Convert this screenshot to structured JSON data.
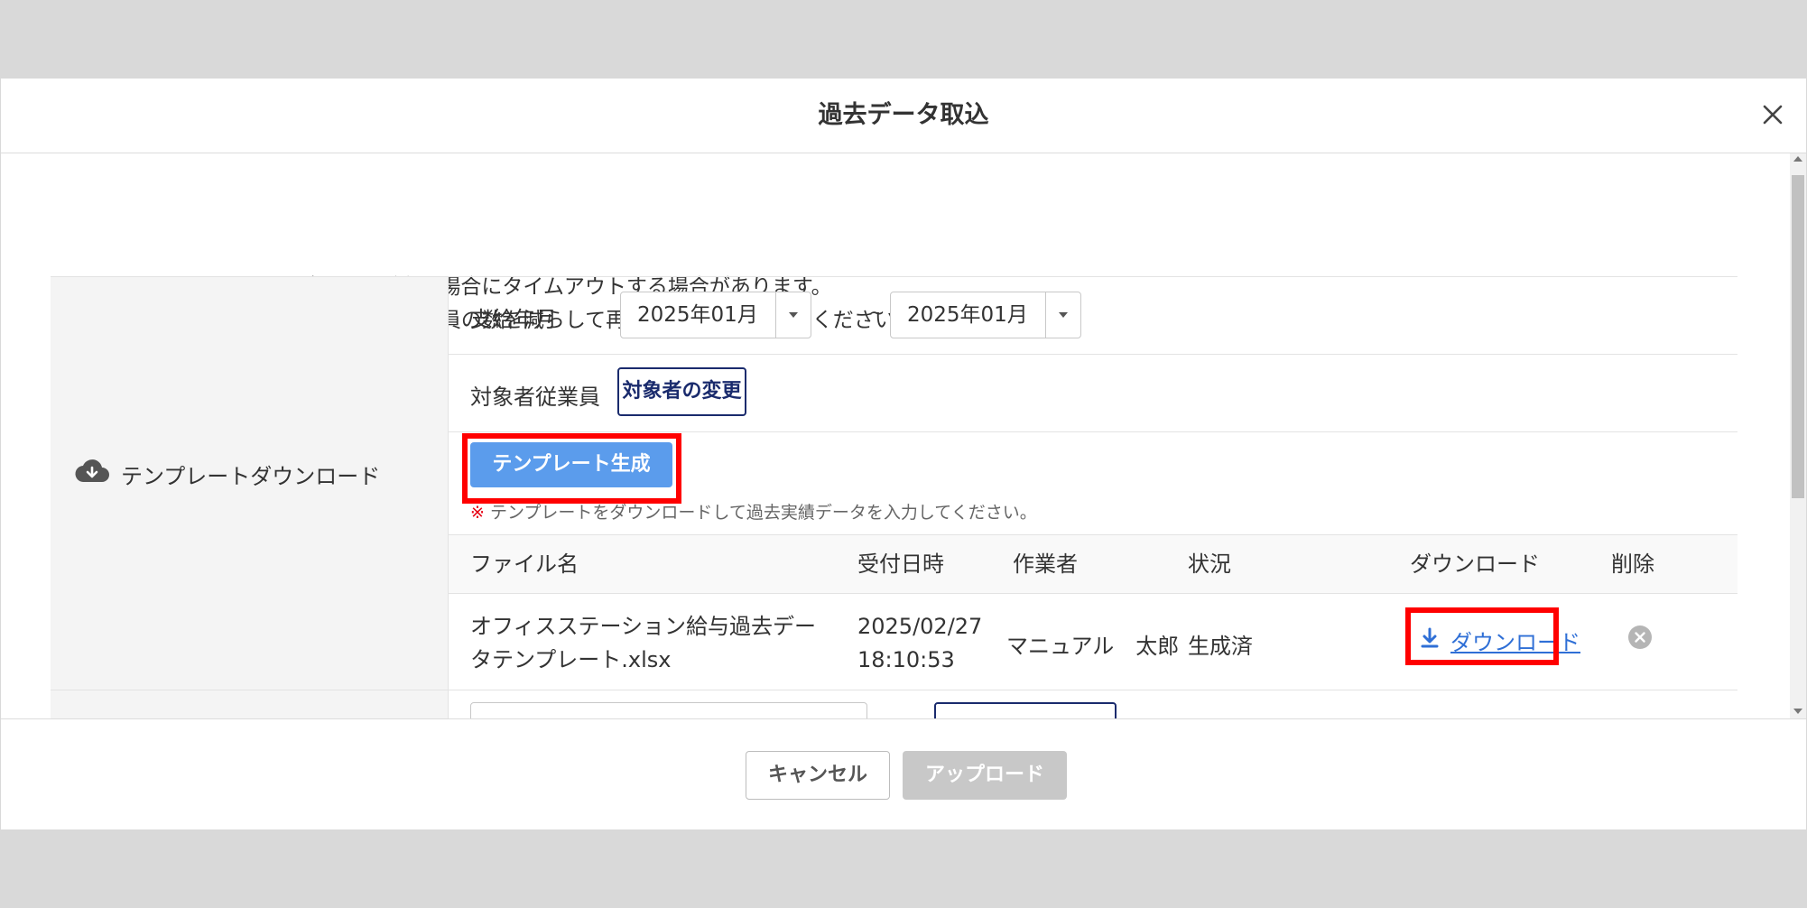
{
  "modal": {
    "title": "過去データ取込",
    "close_icon": "close-icon"
  },
  "notices": [
    {
      "mark": "※",
      "text": "アップロードにあたり、データ量が多い場合にタイムアウトする場合があります。"
    },
    {
      "mark": "※",
      "text": "タイムアウトの際は、取り込みする従業員の数を減らして再度アップロードしてください。"
    }
  ],
  "template_section": {
    "label": "テンプレートダウンロード",
    "icon": "cloud-download-icon",
    "payment_month_label": "支給年月",
    "from_value": "2025年01月",
    "tilde": "~",
    "to_value": "2025年01月",
    "employees_label": "対象者従業員",
    "change_button": "対象者の変更",
    "generate_button": "テンプレート生成",
    "hint_mark": "※",
    "hint_text": "テンプレートをダウンロードして過去実績データを入力してください。"
  },
  "table": {
    "headers": [
      "ファイル名",
      "受付日時",
      "作業者",
      "状況",
      "ダウンロード",
      "削除"
    ],
    "rows": [
      {
        "file_line1": "オフィスステーション給与過去デー",
        "file_line2": "タテンプレート.xlsx",
        "date_line1": "2025/02/27",
        "date_line2": "18:10:53",
        "worker": "マニュアル　太郎",
        "status": "生成済",
        "download_label": "ダウンロード"
      }
    ]
  },
  "footer": {
    "cancel_label": "キャンセル",
    "upload_label": "アップロード"
  },
  "colors": {
    "accent": "#5b9cec",
    "navy": "#1a2b6d",
    "highlight": "#ff0000",
    "link": "#2f6fd6"
  }
}
